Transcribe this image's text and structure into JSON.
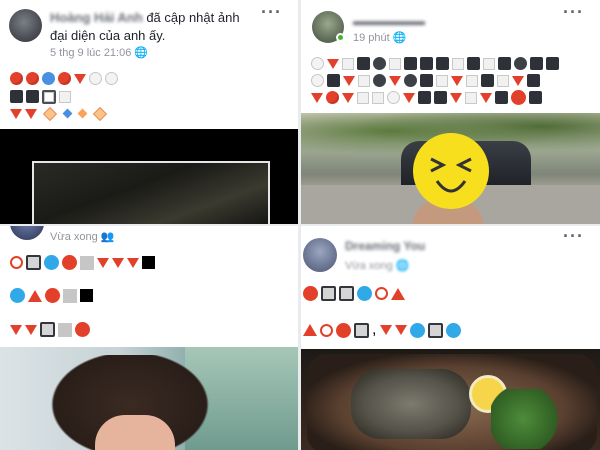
{
  "top_left": {
    "author": "Hoàng Hải Anh",
    "action_line1": "đã cập nhật ảnh",
    "action_line2": "đại diện của anh ấy.",
    "timestamp": "5 thg 9 lúc 21:06",
    "menu": "···"
  },
  "top_right": {
    "timestamp": "19 phút",
    "menu": "···",
    "sticker_icon": "laughing-face-icon"
  },
  "bottom_left": {
    "timestamp": "Vừa xong",
    "visibility_icon": "friends-icon"
  },
  "bottom_right": {
    "author": "Dreaming You",
    "timestamp": "Vừa xong",
    "menu": "···",
    "comma": ","
  },
  "colors": {
    "red": "#e2402a",
    "blue": "#4a90e2",
    "black": "#2e3238",
    "facebook_bg": "#e9ebee"
  }
}
